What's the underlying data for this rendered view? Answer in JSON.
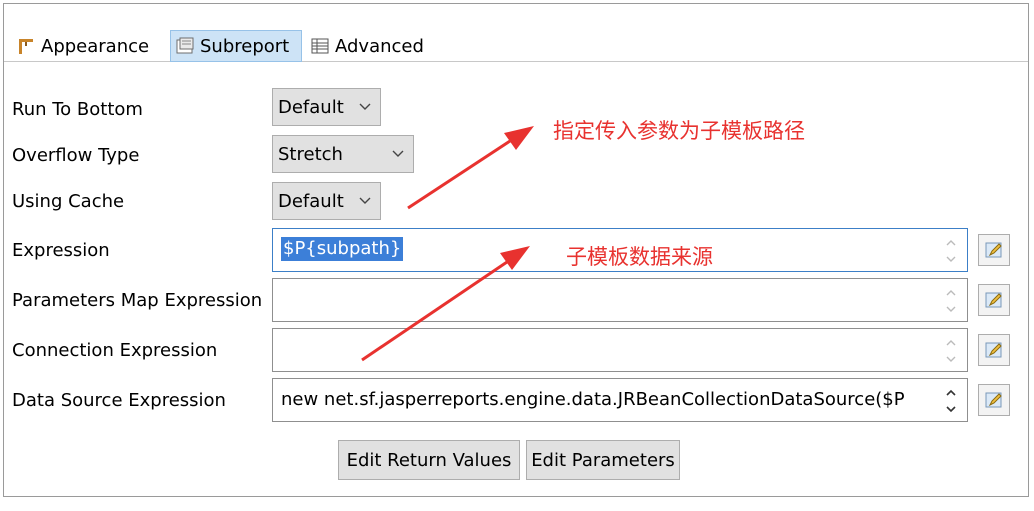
{
  "tabs": [
    {
      "label": "Appearance",
      "icon": "appearance-icon"
    },
    {
      "label": "Subreport",
      "icon": "subreport-icon",
      "active": true
    },
    {
      "label": "Advanced",
      "icon": "advanced-icon"
    }
  ],
  "fields": {
    "run_to_bottom": {
      "label": "Run To Bottom",
      "value": "Default"
    },
    "overflow_type": {
      "label": "Overflow Type",
      "value": "Stretch"
    },
    "using_cache": {
      "label": "Using Cache",
      "value": "Default"
    },
    "expression": {
      "label": "Expression",
      "value": "$P{subpath}"
    },
    "parameters_map_expression": {
      "label": "Parameters Map Expression",
      "value": ""
    },
    "connection_expression": {
      "label": "Connection Expression",
      "value": ""
    },
    "data_source_expression": {
      "label": "Data Source Expression",
      "value": "new net.sf.jasperreports.engine.data.JRBeanCollectionDataSource($P"
    }
  },
  "buttons": {
    "edit_return_values": "Edit Return Values",
    "edit_parameters": "Edit Parameters"
  },
  "annotations": {
    "top": "指定传入参数为子模板路径",
    "middle": "子模板数据来源"
  },
  "colors": {
    "annotation": "#e8322f",
    "selection": "#3c7fd8",
    "active_tab": "#cde3f6"
  }
}
